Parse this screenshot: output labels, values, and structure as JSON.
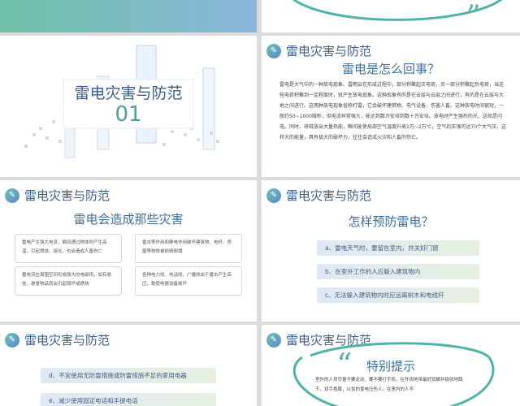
{
  "slide1": {
    "title": "雷电灾害与防范",
    "number": "01"
  },
  "slide2": {
    "header": "雷电灾害与防范",
    "subtitle": "雷电是怎么回事？",
    "paragraph": "雷电是大气中的一种放电现象。雷雨云在形成过程中，部分积聚起正电荷，另一部分积聚起负电荷，当这些电荷积聚到一定程度时，就产生放电现象。这种现象有的是在云层与云层之间进行，有的是在云层与大地之间进行。这两种放电现象俗称打雷，它会破坏建筑物、电气设备，伤害人畜。这种放电时间很短，一般约50~1000微秒，但电流异常强大，能达到数万安培到数十万安培。放电时产生强烈的光，这就是闪电。同时，将释放出大量热能，瞬间能使局部空气温度升高1万~2万℃，空气的压强可达70个大气压，这样大的能量，具有极大的破坏力，往往会造成火灾和人畜的伤亡。"
  },
  "slide3": {
    "header": "雷电灾害与防范",
    "subtitle": "雷电会造成那些灾害",
    "boxes": [
      "雷电产生强大电流，瞬间通过物体时产生高温，引起燃烧、熔化，也会造成人畜伤亡",
      "雷击等作用和静电作用破坏建筑物、电杆、房屋等物体被损毁倒塌",
      "雷电流在周围空间形成强大的电磁场，如有悬挂、悬垂物品就会引起毁坏或燃烧",
      "各种电力线、电话线、广播线由于雷击产生高压，致使电器设备损坏"
    ]
  },
  "slide4": {
    "header": "雷电灾害与防范",
    "subtitle": "怎样预防雷电？",
    "items": [
      "a、雷电天气时，要留在室内，并关好门窗",
      "b、在室外工作的人应躲入建筑物内",
      "c、无法躲入建筑物内时应远离树木和电线杆"
    ]
  },
  "slide5": {
    "header": "雷电灾害与防范",
    "items": [
      "d、不宜使用无防雷措施或防雷措施不足的家用电器",
      "e、减少使用固定电话和手提电话"
    ]
  },
  "slide6": {
    "header": "雷电灾害与防范",
    "subtitle": "特别提示",
    "paragraph": "室外的人员尽量不要走动，要不要打手机，在开阔地带最好双脚并拢就地蹲下，双手抱膝，以免的使电压伤人。在室内的人不"
  },
  "colors": {
    "accent": "#3f6f98",
    "teal": "#4fb3a5",
    "green": "#8fc98a"
  }
}
